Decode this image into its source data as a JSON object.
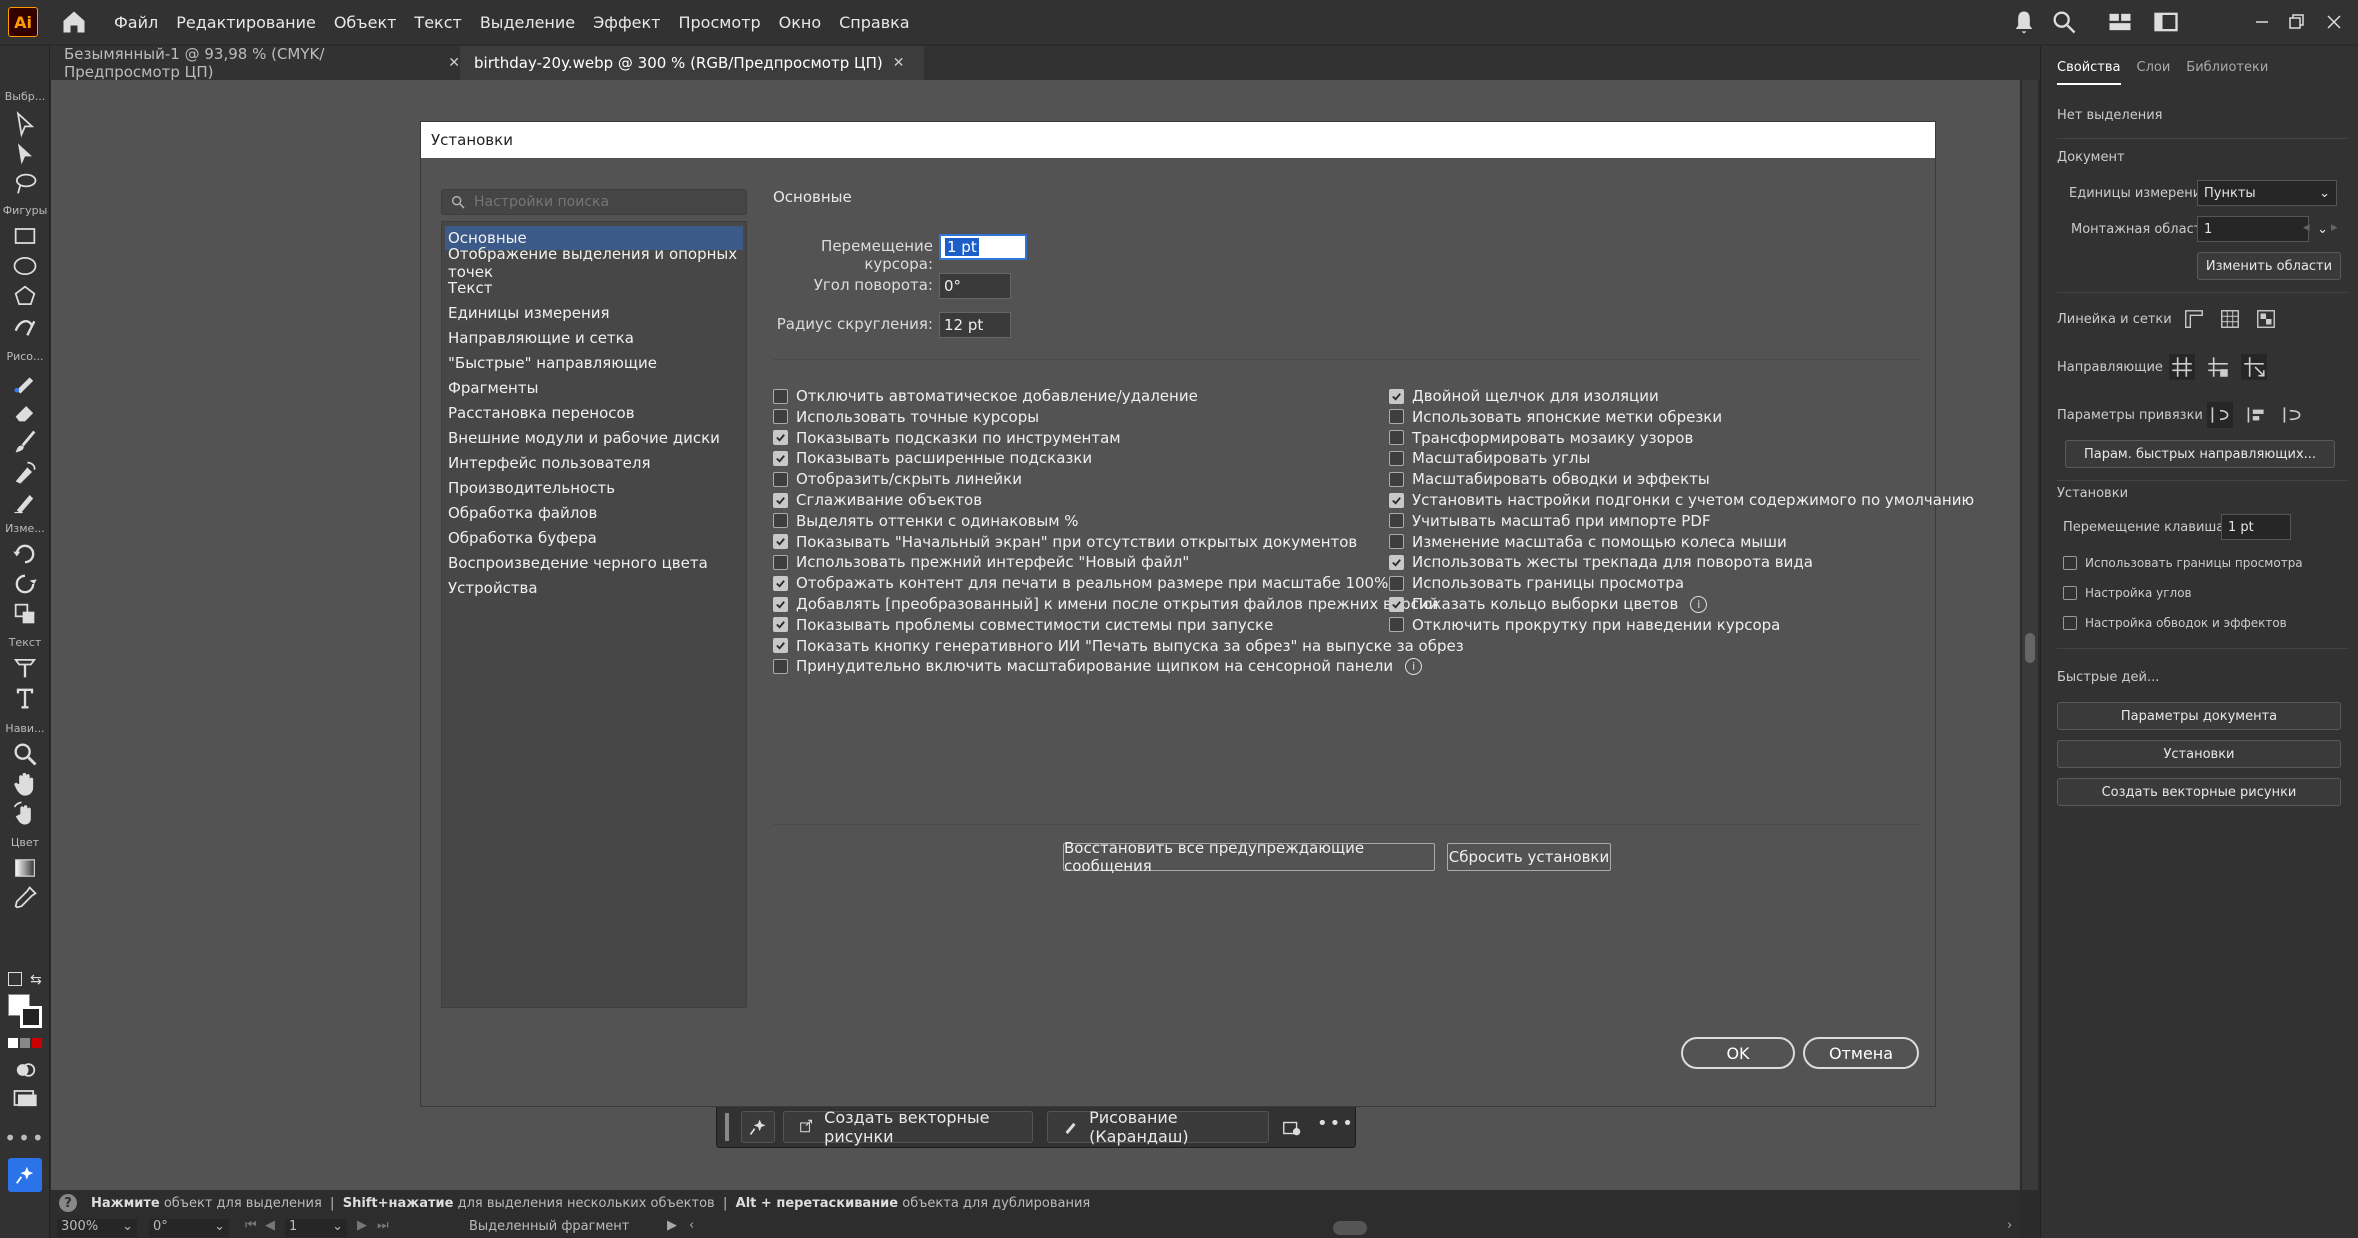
{
  "app": {
    "logo": "Ai"
  },
  "menu": [
    "Файл",
    "Редактирование",
    "Объект",
    "Текст",
    "Выделение",
    "Эффект",
    "Просмотр",
    "Окно",
    "Справка"
  ],
  "tabs": [
    {
      "label": "Безымянный-1 @ 93,98 % (CMYK/Предпросмотр ЦП)"
    },
    {
      "label": "birthday-20y.webp @ 300 % (RGB/Предпросмотр ЦП)"
    }
  ],
  "toolbar": {
    "labels": [
      "Выбр...",
      "Фигуры",
      "Рисо...",
      "Изме...",
      "Текст",
      "Нави...",
      "Цвет"
    ]
  },
  "dialog": {
    "title": "Установки",
    "search_placeholder": "Настройки поиска",
    "nav": [
      "Основные",
      "Отображение выделения и опорных точек",
      "Текст",
      "Единицы измерения",
      "Направляющие и сетка",
      "\"Быстрые\" направляющие",
      "Фрагменты",
      "Расстановка переносов",
      "Внешние модули и рабочие диски",
      "Интерфейс пользователя",
      "Производительность",
      "Обработка файлов",
      "Обработка буфера",
      "Воспроизведение черного цвета",
      "Устройства"
    ],
    "section": "Основные",
    "fields": [
      {
        "label": "Перемещение курсора:",
        "value": "1 pt"
      },
      {
        "label": "Угол поворота:",
        "value": "0°"
      },
      {
        "label": "Радиус скругления:",
        "value": "12 pt"
      }
    ],
    "left_checks": [
      {
        "label": "Отключить автоматическое добавление/удаление",
        "checked": false
      },
      {
        "label": "Использовать точные курсоры",
        "checked": false
      },
      {
        "label": "Показывать подсказки по инструментам",
        "checked": true
      },
      {
        "label": "Показывать расширенные подсказки",
        "checked": true
      },
      {
        "label": "Отобразить/скрыть линейки",
        "checked": false
      },
      {
        "label": "Сглаживание объектов",
        "checked": true
      },
      {
        "label": "Выделять оттенки с одинаковым %",
        "checked": false
      },
      {
        "label": "Показывать \"Начальный экран\" при отсутствии открытых документов",
        "checked": true
      },
      {
        "label": "Использовать прежний интерфейс \"Новый файл\"",
        "checked": false
      },
      {
        "label": "Отображать контент для печати в реальном размере при масштабе 100%",
        "checked": true
      },
      {
        "label": "Добавлять [преобразованный] к имени после открытия файлов прежних версий",
        "checked": true
      },
      {
        "label": "Показывать проблемы совместимости системы при запуске",
        "checked": true
      },
      {
        "label": "Показать кнопку генеративного ИИ \"Печать выпуска за обрез\" на выпуске за обрез",
        "checked": true
      },
      {
        "label": "Принудительно включить масштабирование щипком на сенсорной панели",
        "checked": false,
        "info": true
      }
    ],
    "right_checks": [
      {
        "label": "Двойной щелчок для изоляции",
        "checked": true
      },
      {
        "label": "Использовать японские метки обрезки",
        "checked": false
      },
      {
        "label": "Трансформировать мозаику узоров",
        "checked": false
      },
      {
        "label": "Масштабировать углы",
        "checked": false
      },
      {
        "label": "Масштабировать обводки и эффекты",
        "checked": false
      },
      {
        "label": "Установить настройки подгонки с учетом содержимого по умолчанию",
        "checked": true
      },
      {
        "label": "Учитывать масштаб при импорте PDF",
        "checked": false
      },
      {
        "label": "Изменение масштаба с помощью колеса мыши",
        "checked": false
      },
      {
        "label": "Использовать жесты трекпада для поворота вида",
        "checked": true
      },
      {
        "label": "Использовать границы просмотра",
        "checked": false
      },
      {
        "label": "Показать кольцо выборки цветов",
        "checked": true,
        "info": true
      },
      {
        "label": "Отключить прокрутку при наведении курсора",
        "checked": false
      }
    ],
    "reset_warnings": "Восстановить все предупреждающие сообщения",
    "reset_prefs": "Сбросить установки",
    "ok": "OK",
    "cancel": "Отмена"
  },
  "context_bar": {
    "vectorize": "Создать векторные рисунки",
    "draw": "Рисование (Карандаш)"
  },
  "panel": {
    "tabs": [
      "Свойства",
      "Слои",
      "Библиотеки"
    ],
    "no_selection": "Нет выделения",
    "document": "Документ",
    "units_label": "Единицы измерения:",
    "units_value": "Пункты",
    "artboard_label": "Монтажная область:",
    "artboard_value": "1",
    "edit_artboards": "Изменить области",
    "rulers": "Линейка и сетки",
    "guides": "Направляющие",
    "snap": "Параметры привязки",
    "smart_guides_btn": "Парам. быстрых направляющих...",
    "prefs": "Установки",
    "key_increment_label": "Перемещение клавишами:",
    "key_increment_value": "1 pt",
    "use_preview_bounds": "Использовать границы просмотра",
    "scale_corners": "Настройка углов",
    "scale_strokes": "Настройка обводок и эффектов",
    "quick_actions": "Быстрые дей...",
    "doc_setup": "Параметры документа",
    "preferences": "Установки",
    "create_vector": "Создать векторные рисунки"
  },
  "status": {
    "b1": "Нажмите",
    "t1": "объект для выделения",
    "sep": "|",
    "b2": "Shift+нажатие",
    "t2": "для выделения нескольких объектов",
    "b3": "Alt + перетаскивание",
    "t3": "объекта для дублирования"
  },
  "bottom": {
    "zoom": "300%",
    "angle": "0°",
    "artboard": "1",
    "selection": "Выделенный фрагмент"
  }
}
